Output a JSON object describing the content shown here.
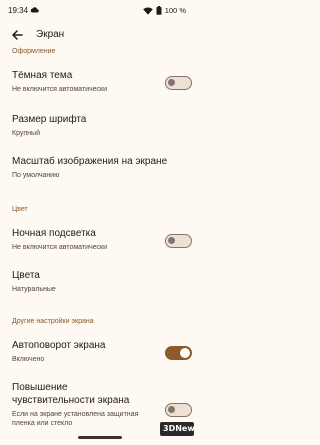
{
  "status_bar": {
    "time": "19:34",
    "battery": "100 %",
    "icons": [
      "cloud-icon",
      "wifi-icon",
      "battery-icon"
    ]
  },
  "app_bar": {
    "title": "Экран",
    "back_icon": "arrow-back-icon"
  },
  "sections": {
    "appearance": "Оформление",
    "color": "Цвет",
    "other": "Другие настройки экрана"
  },
  "items": {
    "dark_theme": {
      "title": "Тёмная тема",
      "subtitle": "Не включится автоматически",
      "enabled": false
    },
    "font_size": {
      "title": "Размер шрифта",
      "subtitle": "Крупный"
    },
    "display_size": {
      "title": "Масштаб изображения на экране",
      "subtitle": "По умолчанию"
    },
    "night_light": {
      "title": "Ночная подсветка",
      "subtitle": "Не включится автоматически",
      "enabled": false
    },
    "colors": {
      "title": "Цвета",
      "subtitle": "Натуральные"
    },
    "auto_rotate": {
      "title": "Автоповорот экрана",
      "subtitle": "Включено",
      "enabled": true
    },
    "touch_sensitivity": {
      "title_line1": "Повышение",
      "title_line2": "чувствительности экрана",
      "subtitle_line1": "Если на экране установлена защитная",
      "subtitle_line2": "пленка или стекло",
      "enabled": false
    }
  },
  "colors": {
    "background": "#fef9f3",
    "accent": "#8c5a2b",
    "text_primary": "#201b16",
    "text_secondary": "#51443a",
    "switch_off": "#84746a"
  },
  "watermark": "3DNews"
}
